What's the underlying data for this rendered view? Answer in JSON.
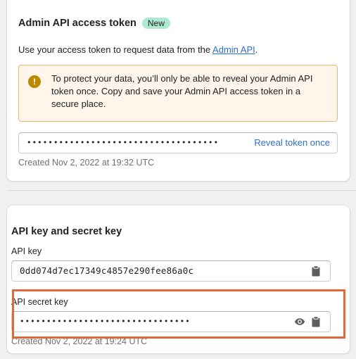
{
  "token_card": {
    "title": "Admin API access token",
    "badge": "New",
    "intro_prefix": "Use your access token to request data from the ",
    "intro_link": "Admin API",
    "intro_suffix": ".",
    "banner_text": "To protect your data, you’ll only be able to reveal your Admin API token once. Copy and save your Admin API access token in a secure place.",
    "token_masked": "••••••••••••••••••••••••••••••••••••",
    "reveal_label": "Reveal token once",
    "created": "Created Nov 2, 2022 at 19:32 UTC"
  },
  "keys_card": {
    "title": "API key and secret key",
    "api_key_label": "API key",
    "api_key_value": "0dd074d7ec17349c4857e290fee86a0c",
    "secret_label": "API secret key",
    "secret_masked": "••••••••••••••••••••••••••••••••",
    "created": "Created Nov 2, 2022 at 19:24 UTC"
  },
  "colors": {
    "accent_link": "#2c6ecb",
    "badge_bg": "#aee9d1",
    "banner_bg": "#fff5ea",
    "banner_border": "#e1b878",
    "warning_icon": "#b98900",
    "highlight": "#e0683a"
  },
  "icons": {
    "warning": "warning-circle-icon",
    "eye": "eye-icon",
    "clipboard": "clipboard-icon"
  }
}
